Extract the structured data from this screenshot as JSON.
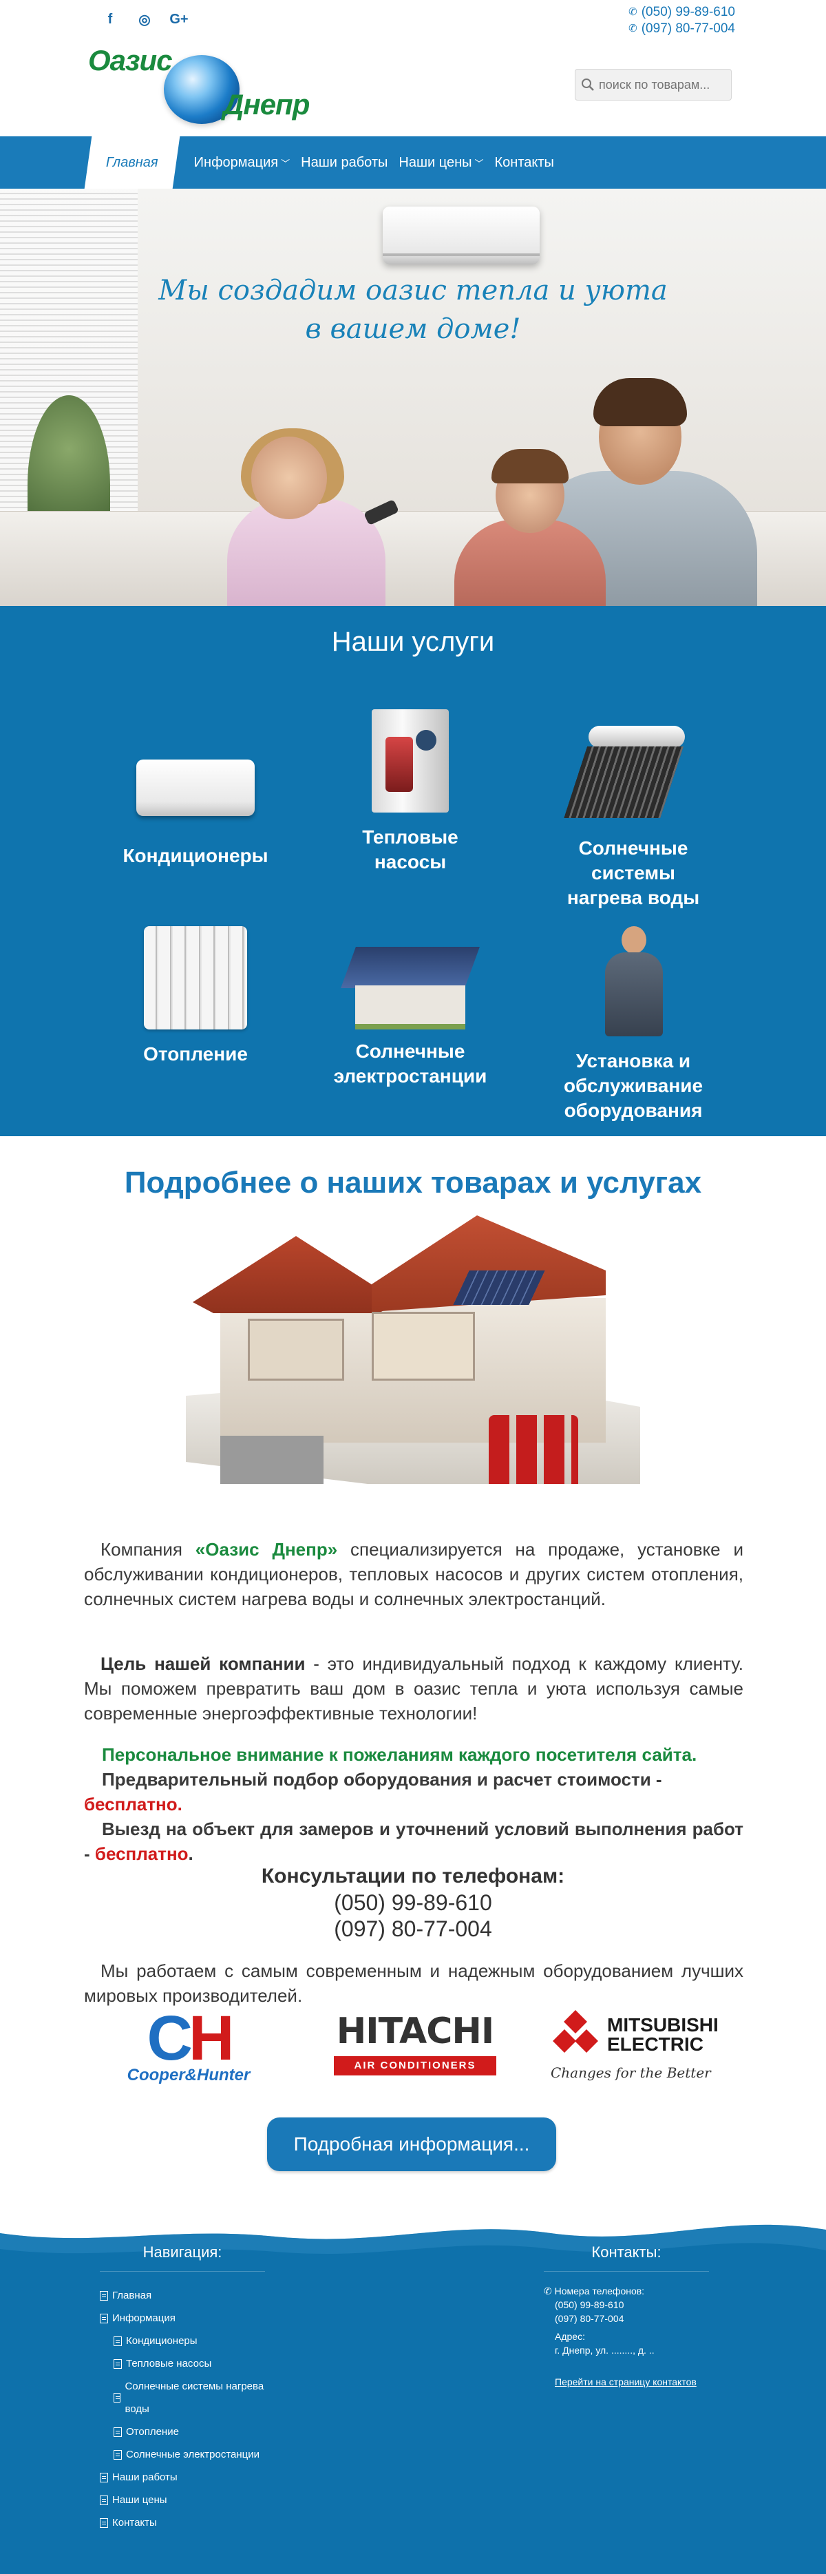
{
  "header": {
    "social": [
      "f",
      "◎",
      "G+"
    ],
    "social_icons": [
      "facebook-icon",
      "instagram-icon",
      "google-plus-icon"
    ],
    "phones": [
      "(050) 99-89-610",
      "(097) 80-77-004"
    ],
    "logo": {
      "word1": "Оазис",
      "word2": "Днепр"
    },
    "search": {
      "placeholder": "поиск по товарам..."
    }
  },
  "nav": {
    "items": [
      {
        "label": "Главная",
        "active": true
      },
      {
        "label": "Информация",
        "dropdown": true
      },
      {
        "label": "Наши работы"
      },
      {
        "label": "Наши цены",
        "dropdown": true
      },
      {
        "label": "Контакты"
      }
    ]
  },
  "hero": {
    "slogan_line1": "Мы создадим оазис тепла и уюта",
    "slogan_line2": "в вашем доме!"
  },
  "services": {
    "title": "Наши услуги",
    "items": [
      {
        "label": "Кондиционеры",
        "icon": "air-conditioner-icon"
      },
      {
        "label": "Тепловые насосы",
        "icon": "heat-pump-icon"
      },
      {
        "label": "Солнечные системы нагрева воды",
        "icon": "solar-water-heater-icon"
      },
      {
        "label": "Отопление",
        "icon": "radiator-icon"
      },
      {
        "label": "Солнечные электростанции",
        "icon": "solar-power-house-icon"
      },
      {
        "label": "Установка и обслуживание оборудования",
        "icon": "technician-icon"
      }
    ]
  },
  "details": {
    "title": "Подробнее о наших товарах и услугах",
    "p1_before": "Компания ",
    "p1_company": "«Оазис Днепр»",
    "p1_after": " специализируется на продаже, установке и обслуживании кондиционеров, тепловых насосов и других систем отопления, солнечных систем нагрева воды и солнечных электростанций.",
    "p2_bold": "Цель нашей компании",
    "p2_rest": " - это индивидуальный подход к каждому клиенту. Мы поможем превратить ваш дом в оазис тепла и уюта используя самые современные энергоэффективные технологии!",
    "personal": "Персональное внимание к пожеланиям каждого посетителя сайта.",
    "pre_select": "Предварительный подбор оборудования и расчет стоимости -",
    "free1": "бесплатно.",
    "visit": "Выезд на объект для замеров и уточнений условий выполнения работ -",
    "free2": "бесплатно",
    "dot": ".",
    "consult_title": "Консультации по телефонам:",
    "consult_phones": [
      "(050) 99-89-610",
      "(097) 80-77-004"
    ],
    "p4": "Мы работаем с самым современным и надежным оборудованием лучших мировых производителей."
  },
  "brands": {
    "cooper": {
      "mark_c": "C",
      "mark_h": "H",
      "sub": "Cooper&Hunter"
    },
    "hitachi": {
      "mark": "HITACHI",
      "sub": "AIR CONDITIONERS"
    },
    "mitsubishi": {
      "line1": "MITSUBISHI",
      "line2": "ELECTRIC",
      "sub": "Changes for the Better"
    }
  },
  "more_button": "Подробная информация...",
  "footer": {
    "nav_title": "Навигация:",
    "nav_items": [
      {
        "label": "Главная",
        "sub": false
      },
      {
        "label": "Информация",
        "sub": false
      },
      {
        "label": "Кондиционеры",
        "sub": true
      },
      {
        "label": "Тепловые насосы",
        "sub": true
      },
      {
        "label": "Солнечные системы нагрева воды",
        "sub": true
      },
      {
        "label": "Отопление",
        "sub": true
      },
      {
        "label": "Солнечные электростанции",
        "sub": true
      },
      {
        "label": "Наши работы",
        "sub": false
      },
      {
        "label": "Наши цены",
        "sub": false
      },
      {
        "label": "Контакты",
        "sub": false
      }
    ],
    "contacts_title": "Контакты:",
    "phones_label": "Номера телефонов:",
    "phones": [
      "(050) 99-89-610",
      "(097) 80-77-004"
    ],
    "address_label": "Адрес:",
    "address": "г. Днепр, ул. ........, д. ..",
    "contacts_link": "Перейти на страницу контактов"
  },
  "colors": {
    "brand_blue": "#1a7bb9",
    "services_bg": "#0f74ae",
    "brand_green": "#1a8a3e",
    "accent_red": "#d11b1b"
  }
}
